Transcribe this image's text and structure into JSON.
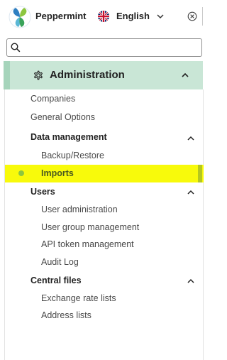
{
  "header": {
    "app_name": "Peppermint",
    "language": "English",
    "flag_icon": "uk-flag-icon"
  },
  "search": {
    "placeholder": "",
    "value": ""
  },
  "menu": {
    "section_title": "Administration",
    "items": [
      {
        "label": "Companies"
      },
      {
        "label": "General Options"
      }
    ],
    "groups": [
      {
        "label": "Data management",
        "items": [
          "Backup/Restore",
          "Imports"
        ]
      },
      {
        "label": "Users",
        "items": [
          "User administration",
          "User group management",
          "API token management",
          "Audit Log"
        ]
      },
      {
        "label": "Central files",
        "items": [
          "Exchange rate lists",
          "Address lists"
        ]
      }
    ],
    "active_item": "Imports"
  },
  "colors": {
    "section_header_bg": "#c9e6d6",
    "active_highlight": "#f8fa0b",
    "active_dot": "#8dc63f"
  }
}
